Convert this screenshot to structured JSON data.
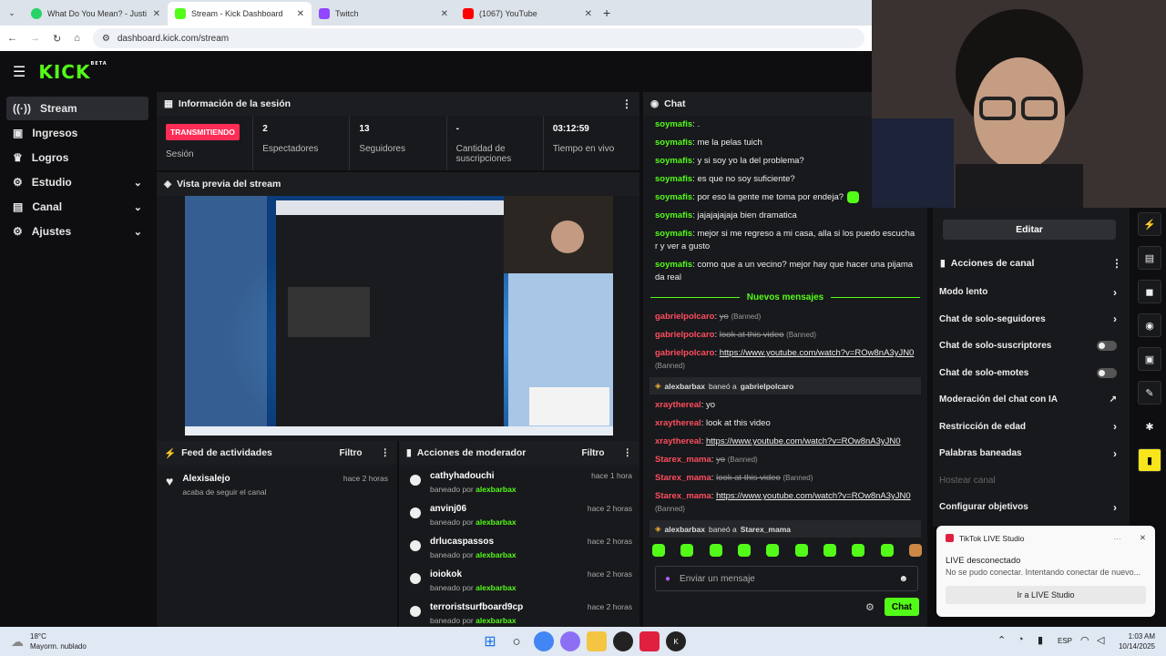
{
  "browser": {
    "tabs": [
      {
        "title": "What Do You Mean? - Justi",
        "color": "#25d366",
        "active": false
      },
      {
        "title": "Stream - Kick Dashboard",
        "color": "#53fc18",
        "active": true
      },
      {
        "title": "Twitch",
        "color": "#9146ff",
        "active": false
      },
      {
        "title": "(1067) YouTube",
        "color": "#ff0000",
        "active": false
      }
    ],
    "url": "dashboard.kick.com/stream"
  },
  "brand": {
    "logo": "KICK",
    "badge": "BETA",
    "accent": "#53fc18"
  },
  "sidebar": {
    "items": [
      {
        "label": "Stream",
        "icon": "broadcast-icon",
        "active": true,
        "chevron": false
      },
      {
        "label": "Ingresos",
        "icon": "money-icon",
        "active": false,
        "chevron": false
      },
      {
        "label": "Logros",
        "icon": "trophy-icon",
        "active": false,
        "chevron": false
      },
      {
        "label": "Estudio",
        "icon": "gear-icon",
        "active": false,
        "chevron": true
      },
      {
        "label": "Canal",
        "icon": "user-icon",
        "active": false,
        "chevron": true
      },
      {
        "label": "Ajustes",
        "icon": "gear-icon",
        "active": false,
        "chevron": true
      }
    ]
  },
  "session": {
    "title": "Información de la sesión",
    "live_badge": "TRANSMITIENDO",
    "stats": [
      {
        "value": "",
        "label": "Sesión"
      },
      {
        "value": "2",
        "label": "Espectadores"
      },
      {
        "value": "13",
        "label": "Seguidores"
      },
      {
        "value": "-",
        "label": "Cantidad de suscripciones"
      },
      {
        "value": "03:12:59",
        "label": "Tiempo en vivo"
      }
    ]
  },
  "preview": {
    "title": "Vista previa del stream"
  },
  "feed": {
    "title": "Feed de actividades",
    "filter": "Filtro",
    "items": [
      {
        "user": "Alexisalejo",
        "text": "acaba de seguir el canal",
        "time": "hace 2 horas"
      }
    ]
  },
  "mod_actions": {
    "title": "Acciones de moderador",
    "filter": "Filtro",
    "prefix": "baneado por",
    "items": [
      {
        "user": "cathyhadouchi",
        "by": "alexbarbax",
        "time": "hace 1 hora"
      },
      {
        "user": "anvinj06",
        "by": "alexbarbax",
        "time": "hace 2 horas"
      },
      {
        "user": "drlucaspassos",
        "by": "alexbarbax",
        "time": "hace 2 horas"
      },
      {
        "user": "ioiokok",
        "by": "alexbarbax",
        "time": "hace 2 horas"
      },
      {
        "user": "terroristsurfboard9cp",
        "by": "alexbarbax",
        "time": "hace 2 horas"
      }
    ]
  },
  "chat": {
    "title": "Chat",
    "messages": [
      {
        "user": "soymafis",
        "text": ".",
        "style": "normal"
      },
      {
        "user": "soymafis",
        "text": "me la pelas tuich",
        "style": "normal"
      },
      {
        "user": "soymafis",
        "text": "y si soy yo la del problema?",
        "style": "normal"
      },
      {
        "user": "soymafis",
        "text": "es que no soy suficiente?",
        "style": "normal"
      },
      {
        "user": "soymafis",
        "text": "por eso la gente me toma por endeja?",
        "style": "normal"
      },
      {
        "user": "soymafis",
        "text": "jajajajajaja bien dramatica",
        "style": "normal"
      },
      {
        "user": "soymafis",
        "text": "mejor si me regreso a mi casa, alla si los puedo escuchar y ver a gusto",
        "style": "normal"
      },
      {
        "user": "soymafis",
        "text": "como que a un vecino? mejor hay que hacer una pijamada real",
        "style": "normal"
      }
    ],
    "new_label": "Nuevos mensajes",
    "banned_label": "(Banned)",
    "new_messages": [
      {
        "user": "gabrielpolcaro",
        "text": "yo",
        "style": "banned"
      },
      {
        "user": "gabrielpolcaro",
        "text": "look at this video",
        "style": "banned"
      },
      {
        "user": "gabrielpolcaro",
        "text": "https://www.youtube.com/watch?v=ROw8nA3yJN0",
        "style": "banned-link"
      },
      {
        "sys": true,
        "mod": "alexbarbax",
        "action": "baneó a",
        "target": "gabrielpolcaro"
      },
      {
        "user": "xraythereal",
        "text": "yo",
        "style": "normal"
      },
      {
        "user": "xraythereal",
        "text": "look at this video",
        "style": "normal"
      },
      {
        "user": "xraythereal",
        "text": "https://www.youtube.com/watch?v=ROw8nA3yJN0",
        "style": "link"
      },
      {
        "user": "Starex_mama",
        "text": "yo",
        "style": "banned"
      },
      {
        "user": "Starex_mama",
        "text": "look at this video",
        "style": "banned"
      },
      {
        "user": "Starex_mama",
        "text": "https://www.youtube.com/watch?v=ROw8nA3yJN0",
        "style": "banned-link"
      },
      {
        "sys": true,
        "mod": "alexbarbax",
        "action": "baneó a",
        "target": "Starex_mama"
      }
    ],
    "input_placeholder": "Enviar un mensaje",
    "send_label": "Chat"
  },
  "channel_actions": {
    "edit_label": "Editar",
    "title": "Acciones de canal",
    "items": [
      {
        "label": "Modo lento",
        "kind": "arrow"
      },
      {
        "label": "Chat de solo-seguidores",
        "kind": "arrow"
      },
      {
        "label": "Chat de solo-suscriptores",
        "kind": "toggle"
      },
      {
        "label": "Chat de solo-emotes",
        "kind": "toggle"
      },
      {
        "label": "Moderación del chat con IA",
        "kind": "external"
      },
      {
        "label": "Restricción de edad",
        "kind": "arrow"
      },
      {
        "label": "Palabras baneadas",
        "kind": "arrow"
      },
      {
        "label": "Hostear canal",
        "kind": "disabled"
      },
      {
        "label": "Configurar objetivos",
        "kind": "arrow"
      }
    ]
  },
  "toast": {
    "app": "TikTok LIVE Studio",
    "title": "LIVE desconectado",
    "body": "No se pudo conectar. Intentando conectar de nuevo...",
    "button": "Ir a LIVE Studio"
  },
  "taskbar": {
    "weather_temp": "18°C",
    "weather_text": "Mayorm. nublado",
    "lang": "ESP",
    "time": "1:03 AM",
    "date": "10/14/2025"
  }
}
